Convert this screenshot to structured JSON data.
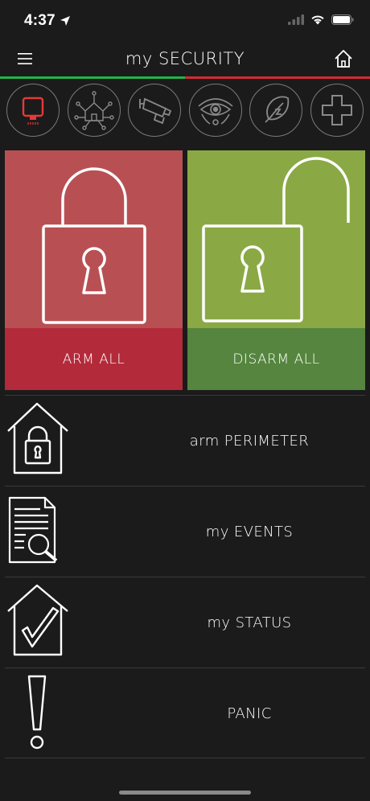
{
  "status_bar": {
    "time": "4:37",
    "icons": [
      "location-arrow-icon",
      "signal-icon",
      "wifi-icon",
      "battery-icon"
    ]
  },
  "header": {
    "title": "my SECURITY",
    "menu_icon": "hamburger-menu-icon",
    "home_icon": "home-icon"
  },
  "colors": {
    "background": "#1b1b1b",
    "accent_green": "#23b34a",
    "accent_red": "#d42a35",
    "arm_tile": "#b85053",
    "arm_label_bg": "#b32a3a",
    "disarm_tile": "#8aa945",
    "disarm_label_bg": "#55853e",
    "active_icon": "#e23a3a"
  },
  "categories": [
    {
      "icon": "alarm-panel-icon",
      "active": true
    },
    {
      "icon": "smart-home-network-icon",
      "active": false
    },
    {
      "icon": "cctv-camera-icon",
      "active": false
    },
    {
      "icon": "surveillance-eye-icon",
      "active": false
    },
    {
      "icon": "energy-leaf-icon",
      "active": false
    },
    {
      "icon": "medical-cross-icon",
      "active": false
    }
  ],
  "tiles": {
    "arm": {
      "label": "ARM ALL",
      "icon": "locked-padlock-icon"
    },
    "disarm": {
      "label": "DISARM ALL",
      "icon": "unlocked-padlock-icon"
    }
  },
  "list": [
    {
      "label": "arm PERIMETER",
      "icon": "house-lock-icon"
    },
    {
      "label": "my EVENTS",
      "icon": "document-search-icon"
    },
    {
      "label": "my STATUS",
      "icon": "house-check-icon"
    },
    {
      "label": "PANIC",
      "icon": "exclamation-icon"
    }
  ]
}
